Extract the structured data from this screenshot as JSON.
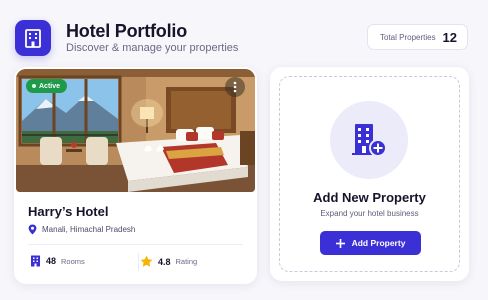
{
  "header": {
    "title": "Hotel Portfolio",
    "subtitle": "Discover & manage your properties",
    "logo_icon": "building-icon",
    "total_label": "Total Properties",
    "total_count": "12"
  },
  "hotel_card": {
    "status": "Active",
    "status_color": "#1e9a4a",
    "name": "Harry’s Hotel",
    "location": "Manali, Himachal Pradesh",
    "rooms_value": "48",
    "rooms_label": "Rooms",
    "rating_value": "4.8",
    "rating_label": "Rating",
    "menu_icon": "more-vertical-icon"
  },
  "add_card": {
    "title": "Add New Property",
    "subtitle": "Expand your hotel business",
    "button_label": "Add Property",
    "icon": "add-building-icon"
  },
  "colors": {
    "accent": "#3b2fd6",
    "star": "#f4b400",
    "background": "#f6f6fb"
  }
}
